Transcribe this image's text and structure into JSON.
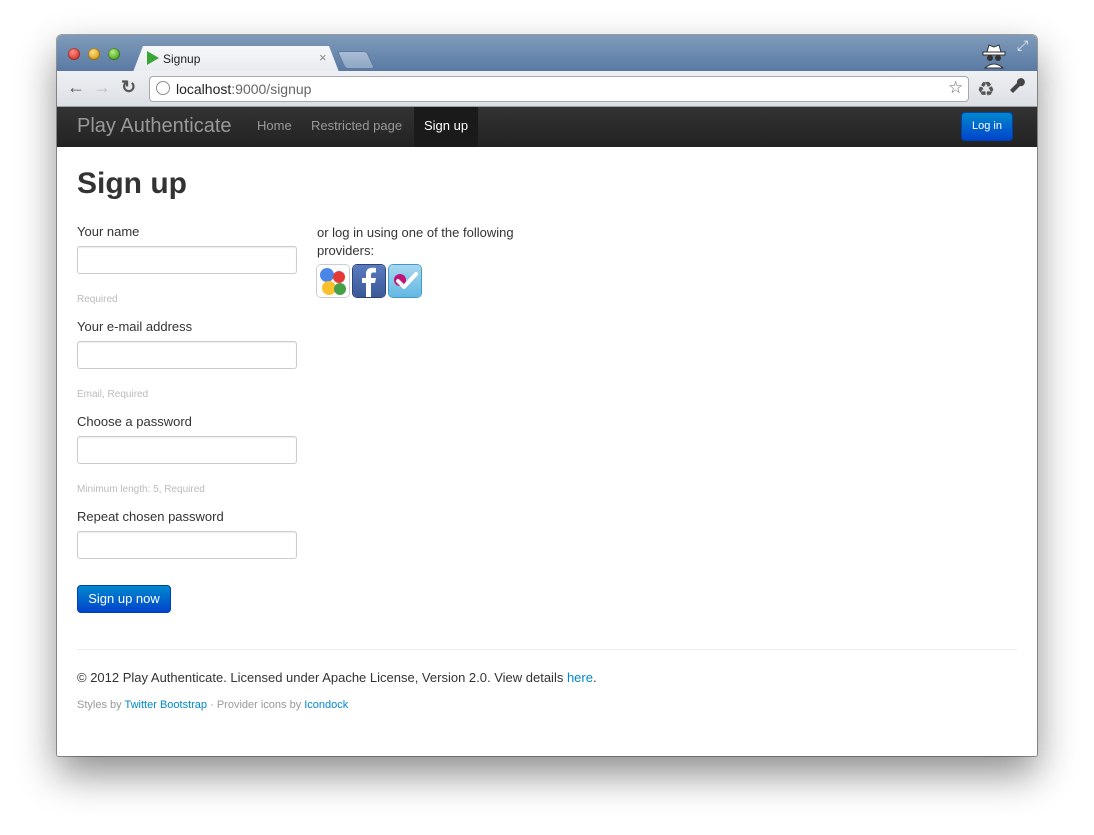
{
  "browser": {
    "tab_title": "Signup",
    "tab_close": "×",
    "url_host": "localhost",
    "url_rest": ":9000/signup"
  },
  "navbar": {
    "brand": "Play Authenticate",
    "items": [
      {
        "label": "Home"
      },
      {
        "label": "Restricted page"
      },
      {
        "label": "Sign up",
        "active": true
      }
    ],
    "login_label": "Log in"
  },
  "page": {
    "title": "Sign up",
    "fields": [
      {
        "label": "Your name",
        "value": "",
        "help": "Required"
      },
      {
        "label": "Your e-mail address",
        "value": "",
        "help": "Email, Required"
      },
      {
        "label": "Choose a password",
        "value": "",
        "help": "Minimum length: 5, Required"
      },
      {
        "label": "Repeat chosen password",
        "value": ""
      }
    ],
    "submit_label": "Sign up now",
    "providers_text": "or log in using one of the following providers:",
    "providers": [
      {
        "name": "google",
        "icon": "google-icon"
      },
      {
        "name": "facebook",
        "icon": "facebook-icon"
      },
      {
        "name": "foursquare",
        "icon": "foursquare-icon"
      }
    ]
  },
  "footer": {
    "copyright_prefix": "© 2012 Play Authenticate. Licensed under Apache License, Version 2.0. View details ",
    "copyright_link": "here",
    "copyright_suffix": ".",
    "styles_prefix": "Styles by ",
    "styles_link": "Twitter Bootstrap",
    "icons_prefix": " · Provider icons by ",
    "icons_link": "Icondock"
  },
  "colors": {
    "primary": "#0088cc",
    "navbar_bg": "#222222"
  }
}
